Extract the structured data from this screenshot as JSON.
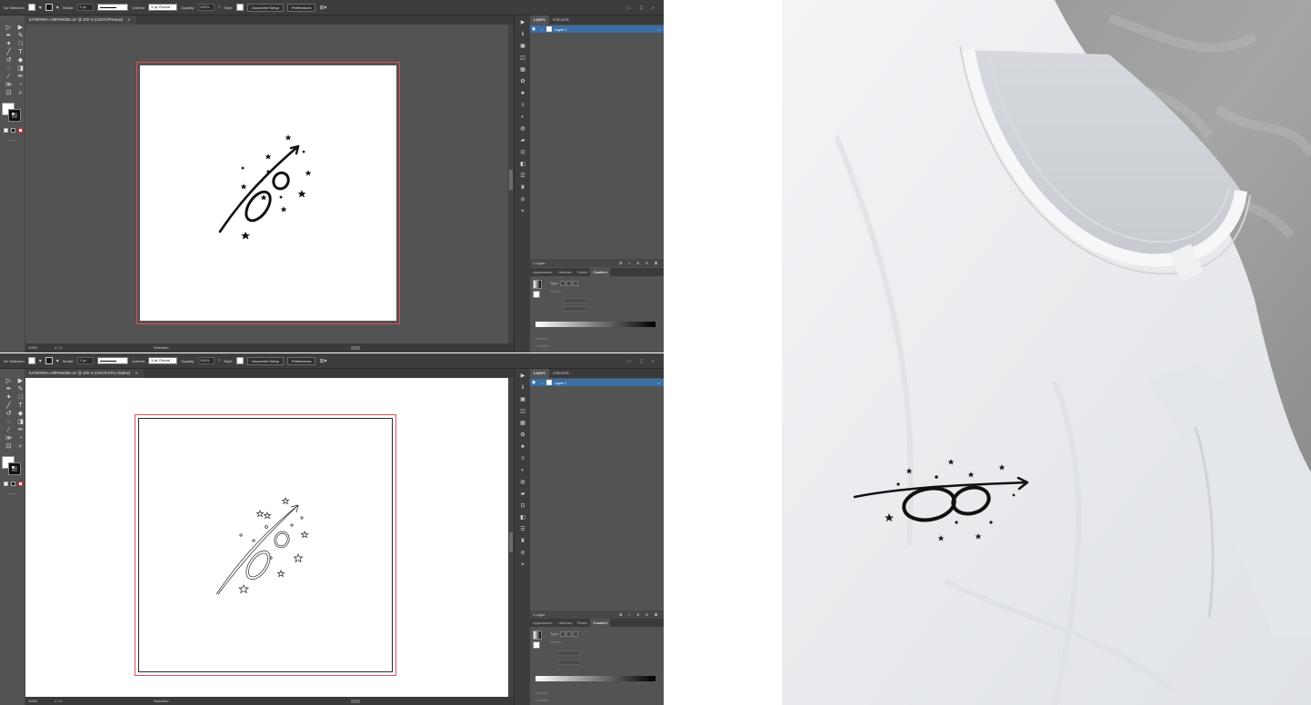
{
  "control_bar": {
    "selection_label": "No Selection",
    "stroke_label": "Stroke:",
    "stroke_weight": "1 px",
    "stroke_style": "Uniform",
    "brush": "5 pt. Round",
    "opacity_label": "Opacity:",
    "opacity_value": "100%",
    "style_label": "Style:",
    "document_setup": "Document Setup",
    "preferences": "Preferences"
  },
  "top_window": {
    "doc_tab": "КАТЕРИНА АФРАМОВА.ai* @ 100 % (CMYK/Preview)",
    "view_mode": "Preview"
  },
  "bottom_window": {
    "doc_tab": "КАТЕРИНА АФРАМОВА.ai* @ 100 % (CMYK/CPU Outline)",
    "view_mode": "Outline"
  },
  "status_bar": {
    "zoom": "100%",
    "rotation": "0°",
    "artboard_nav": "◂  1  ▸",
    "tool": "Selection"
  },
  "layers_panel": {
    "tabs": [
      "Layers",
      "Artboards"
    ],
    "active_tab": "Layers",
    "layer_name": "Layer 1",
    "footer_count": "1 Layer"
  },
  "gradient_panel": {
    "tabs": [
      "Appearance",
      "Libraries",
      "Stroke",
      "Gradient"
    ],
    "active_tab": "Gradient",
    "type_label": "Type:",
    "stroke_label": "Stroke:",
    "opacity_label": "Opacity:",
    "location_label": "Location:"
  },
  "colors": {
    "app_bg": "#535353",
    "chrome": "#3d3d3d",
    "selected_layer": "#3b6ea5",
    "artboard_border": "#e05050",
    "accent_blue": "#2d7ff0"
  },
  "icons": {
    "tools": [
      "selection-tool",
      "direct-selection-tool",
      "pen-tool",
      "curvature-tool",
      "magic-wand-tool",
      "lasso-tool",
      "rectangle-tool",
      "type-tool",
      "line-tool",
      "paintbrush-tool",
      "pencil-tool",
      "eraser-tool",
      "rotate-tool",
      "scale-tool",
      "width-tool",
      "warp-tool",
      "shape-builder-tool",
      "perspective-tool",
      "gradient-tool",
      "eyedropper-tool",
      "blend-tool",
      "symbol-sprayer-tool",
      "artboard-tool",
      "slice-tool",
      "hand-tool",
      "zoom-tool"
    ],
    "strip": [
      "play-icon",
      "info-icon",
      "transform-icon",
      "libraries-icon",
      "swatches-icon",
      "brushes-icon",
      "symbols-icon",
      "graphic-styles-icon",
      "stroke-icon",
      "gradient-icon",
      "transparency-icon",
      "appearance-icon",
      "comment-icon",
      "artboards-icon",
      "layers-icon",
      "align-icon",
      "pathfinder-icon",
      "links-icon",
      "asset-export-icon"
    ]
  },
  "photo": {
    "subject": "white t-shirt with printed logo"
  }
}
